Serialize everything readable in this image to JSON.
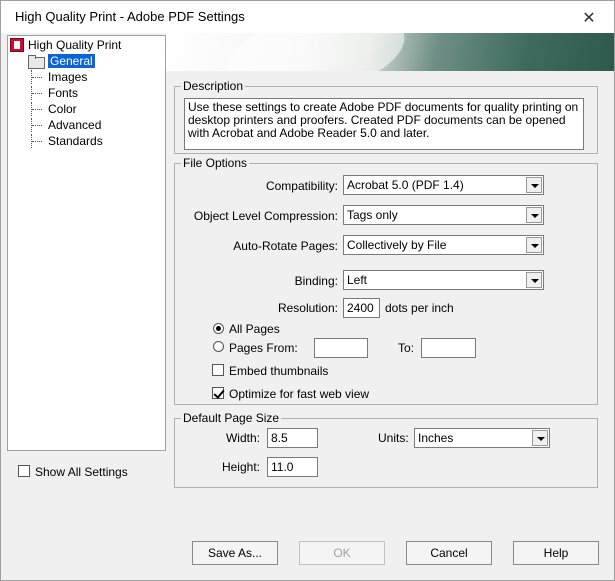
{
  "window": {
    "title": "High Quality Print - Adobe PDF Settings",
    "close_label": "✕"
  },
  "tree": {
    "root": "High Quality Print",
    "items": [
      {
        "label": "General",
        "selected": true
      },
      {
        "label": "Images"
      },
      {
        "label": "Fonts"
      },
      {
        "label": "Color"
      },
      {
        "label": "Advanced"
      },
      {
        "label": "Standards"
      }
    ]
  },
  "show_all": {
    "label": "Show All Settings",
    "checked": false
  },
  "description": {
    "legend": "Description",
    "text": "Use these settings to create Adobe PDF documents for quality printing on desktop printers and proofers.  Created PDF documents can be opened with Acrobat and Adobe Reader 5.0 and later."
  },
  "file_options": {
    "legend": "File Options",
    "compatibility": {
      "label": "Compatibility:",
      "value": "Acrobat 5.0 (PDF 1.4)"
    },
    "compression": {
      "label": "Object Level Compression:",
      "value": "Tags only"
    },
    "autorotate": {
      "label": "Auto-Rotate Pages:",
      "value": "Collectively by File"
    },
    "binding": {
      "label": "Binding:",
      "value": "Left"
    },
    "resolution": {
      "label": "Resolution:",
      "value": "2400",
      "unit": "dots per inch"
    },
    "all_pages": {
      "label": "All Pages",
      "selected": true
    },
    "pages_from": {
      "label": "Pages From:",
      "from_value": "",
      "to_label": "To:",
      "to_value": ""
    },
    "embed_thumbnails": {
      "label": "Embed thumbnails",
      "checked": false
    },
    "optimize_web": {
      "label": "Optimize for fast web view",
      "checked": true
    }
  },
  "page_size": {
    "legend": "Default Page Size",
    "width": {
      "label": "Width:",
      "value": "8.5"
    },
    "height": {
      "label": "Height:",
      "value": "11.0"
    },
    "units": {
      "label": "Units:",
      "value": "Inches"
    }
  },
  "buttons": {
    "save_as": "Save As...",
    "ok": "OK",
    "cancel": "Cancel",
    "help": "Help"
  }
}
